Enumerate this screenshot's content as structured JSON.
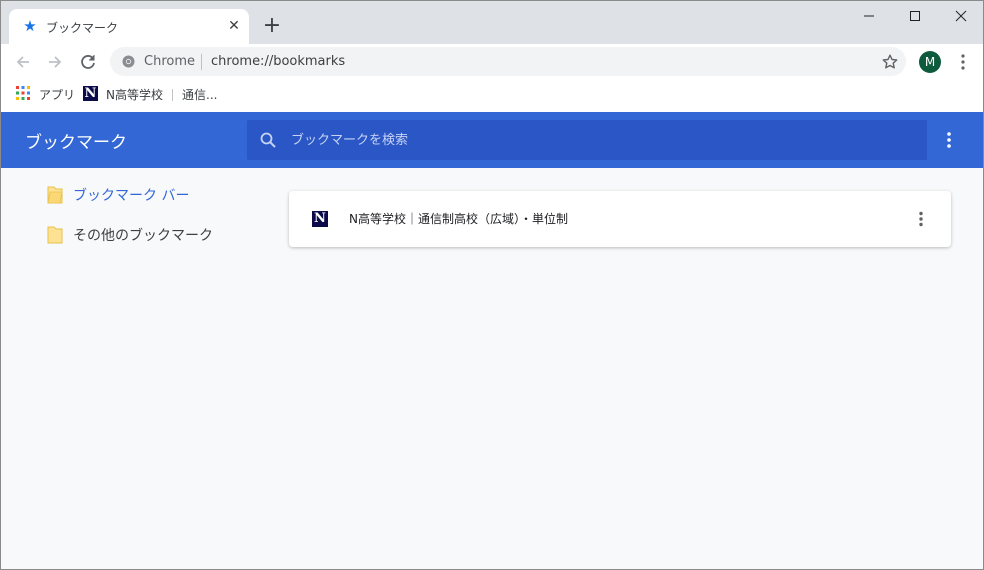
{
  "tab": {
    "title": "ブックマーク",
    "icon": "star-icon"
  },
  "omnibox": {
    "site": "Chrome",
    "url": "chrome://bookmarks"
  },
  "profile": {
    "initial": "M",
    "color": "#0d5a3c"
  },
  "bookmarks_bar": {
    "apps_label": "アプリ",
    "items": [
      {
        "label": "N高等学校"
      },
      {
        "label": "通信..."
      }
    ]
  },
  "manager": {
    "title": "ブックマーク",
    "search_placeholder": "ブックマークを検索",
    "header_color": "#3367d6",
    "folders": [
      {
        "label": "ブックマーク バー",
        "selected": true
      },
      {
        "label": "その他のブックマーク",
        "selected": false
      }
    ],
    "list": [
      {
        "title": "N高等学校｜通信制高校（広域）・単位制",
        "icon_letter": "N"
      }
    ]
  }
}
